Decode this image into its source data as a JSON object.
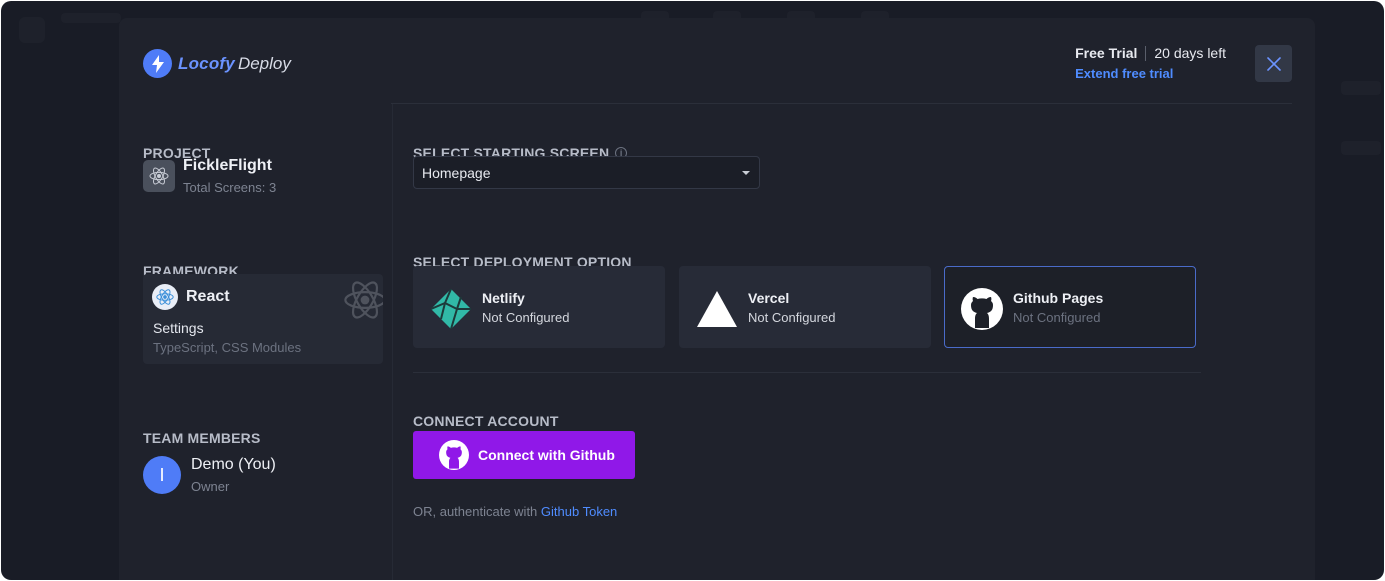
{
  "brand": {
    "name_part1": "Locofy",
    "name_part2": "Deploy",
    "accent": "#4f7cf7"
  },
  "trial": {
    "title": "Free Trial",
    "days_left": "20 days left",
    "extend_link": "Extend free trial"
  },
  "sidebar": {
    "project_label": "PROJECT",
    "project_name": "FickleFlight",
    "project_screens": "Total Screens: 3",
    "framework_label": "FRAMEWORK",
    "framework_name": "React",
    "framework_settings_label": "Settings",
    "framework_settings_value": "TypeScript, CSS Modules",
    "team_label": "TEAM MEMBERS",
    "member_initial": "I",
    "member_name": "Demo (You)",
    "member_role": "Owner"
  },
  "main": {
    "starting_screen_label": "SELECT STARTING SCREEN",
    "starting_screen_value": "Homepage",
    "deployment_label": "SELECT DEPLOYMENT OPTION",
    "options": [
      {
        "name": "Netlify",
        "status": "Not Configured",
        "icon": "netlify-icon"
      },
      {
        "name": "Vercel",
        "status": "Not Configured",
        "icon": "vercel-icon"
      },
      {
        "name": "Github Pages",
        "status": "Not Configured",
        "icon": "github-icon",
        "selected": true
      }
    ],
    "connect_label": "CONNECT ACCOUNT",
    "connect_button": "Connect with Github",
    "alt_text": "OR, authenticate with ",
    "alt_link": "Github Token"
  },
  "colors": {
    "background": "#191c26",
    "modal": "#1f222c",
    "primary_button": "#9018e8",
    "link": "#4f8cff",
    "selected_border": "#4a6bc9"
  }
}
